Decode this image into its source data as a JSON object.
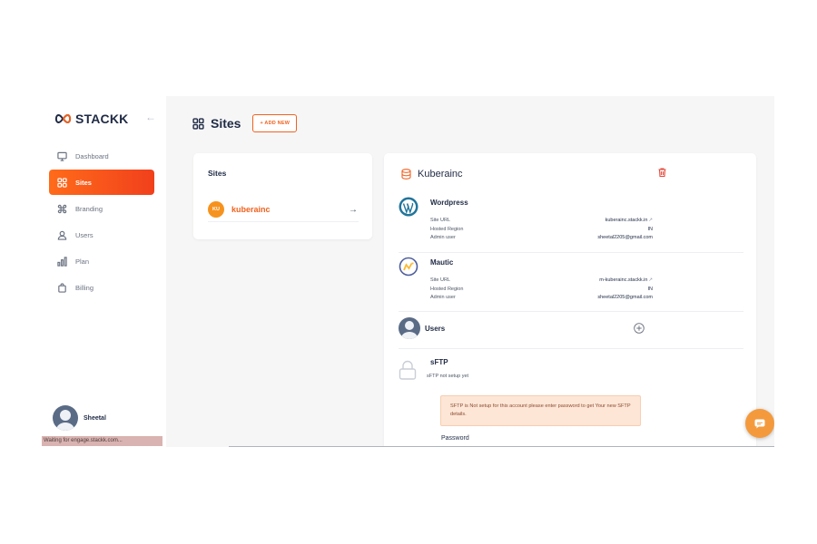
{
  "brand": {
    "name": "STACKK",
    "accent": "#f0621f"
  },
  "sidebar": {
    "items": [
      {
        "label": "Dashboard",
        "icon": "monitor-icon",
        "active": false
      },
      {
        "label": "Sites",
        "icon": "grid-icon",
        "active": true
      },
      {
        "label": "Branding",
        "icon": "command-icon",
        "active": false
      },
      {
        "label": "Users",
        "icon": "user-icon",
        "active": false
      },
      {
        "label": "Plan",
        "icon": "bar-chart-icon",
        "active": false
      },
      {
        "label": "Billing",
        "icon": "bag-icon",
        "active": false
      }
    ],
    "user": {
      "name": "Sheetal"
    }
  },
  "status_bar": {
    "text": "Waiting for engage.stackk.com..."
  },
  "header": {
    "title": "Sites",
    "add_button": "+ ADD NEW"
  },
  "sites_list": {
    "title": "Sites",
    "items": [
      {
        "initials": "KU",
        "name": "kuberainc"
      }
    ]
  },
  "site_detail": {
    "title": "Kuberainc",
    "apps": [
      {
        "name": "Wordpress",
        "icon": "wordpress-icon",
        "rows": [
          {
            "label": "Site URL",
            "value": "kuberainc.stackk.in",
            "external": true
          },
          {
            "label": "Hosted Region",
            "value": "IN",
            "external": false
          },
          {
            "label": "Admin user",
            "value": "sheetal2205@gmail.com",
            "external": false
          }
        ]
      },
      {
        "name": "Mautic",
        "icon": "mautic-icon",
        "rows": [
          {
            "label": "Site URL",
            "value": "m-kuberainc.stackk.in",
            "external": true
          },
          {
            "label": "Hosted Region",
            "value": "IN",
            "external": false
          },
          {
            "label": "Admin user",
            "value": "sheetal2205@gmail.com",
            "external": false
          }
        ]
      }
    ],
    "users": {
      "label": "Users"
    },
    "sftp": {
      "title": "sFTP",
      "subtitle": "sFTP not setup yet",
      "alert": "SFTP is Not setup for this account please enter password to get Your new SFTP details.",
      "password_label": "Password"
    }
  }
}
